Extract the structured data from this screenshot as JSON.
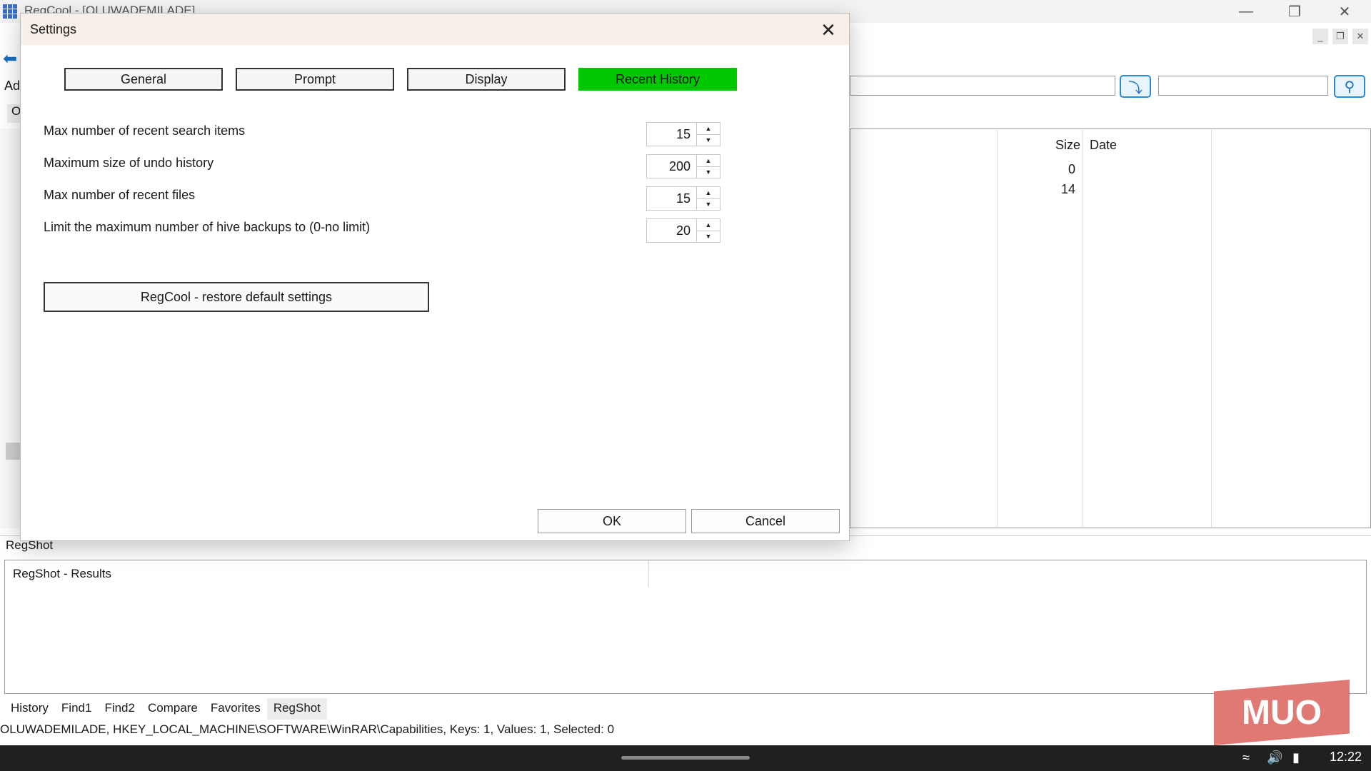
{
  "app": {
    "title": "RegCool - [OLUWADEMILADE]",
    "toolbar_left_label": "Ad",
    "tab_stub": "O"
  },
  "table": {
    "columns": [
      "Size",
      "Date"
    ],
    "rows": [
      {
        "size": "0",
        "date": ""
      },
      {
        "size": "14",
        "date": ""
      }
    ]
  },
  "regshot": {
    "section_label": "RegShot",
    "results_title": "RegShot - Results"
  },
  "bottom_tabs": [
    "History",
    "Find1",
    "Find2",
    "Compare",
    "Favorites",
    "RegShot"
  ],
  "active_bottom_tab": "RegShot",
  "status_bar": "OLUWADEMILADE, HKEY_LOCAL_MACHINE\\SOFTWARE\\WinRAR\\Capabilities, Keys: 1, Values: 1, Selected: 0",
  "taskbar": {
    "clock": "12:22"
  },
  "watermark": "MUO",
  "dialog": {
    "title": "Settings",
    "tabs": [
      "General",
      "Prompt",
      "Display",
      "Recent History"
    ],
    "active_tab": "Recent History",
    "settings": [
      {
        "label": "Max number of recent search items",
        "value": "15"
      },
      {
        "label": "Maximum size of undo history",
        "value": "200"
      },
      {
        "label": "Max number of recent files",
        "value": "15"
      },
      {
        "label": "Limit the maximum number of hive backups to (0-no limit)",
        "value": "20"
      }
    ],
    "restore_button": "RegCool - restore default settings",
    "ok_button": "OK",
    "cancel_button": "Cancel"
  },
  "colors": {
    "active_tab": "#00c800",
    "dialog_titlebar": "#f7efe8",
    "accent_blue": "#2b8ad8"
  },
  "icons": [
    "app-icon",
    "minimize-icon",
    "restore-icon",
    "close-icon",
    "back-arrow-icon",
    "jump-icon",
    "search-icon",
    "wifi-icon",
    "volume-icon",
    "battery-icon"
  ]
}
